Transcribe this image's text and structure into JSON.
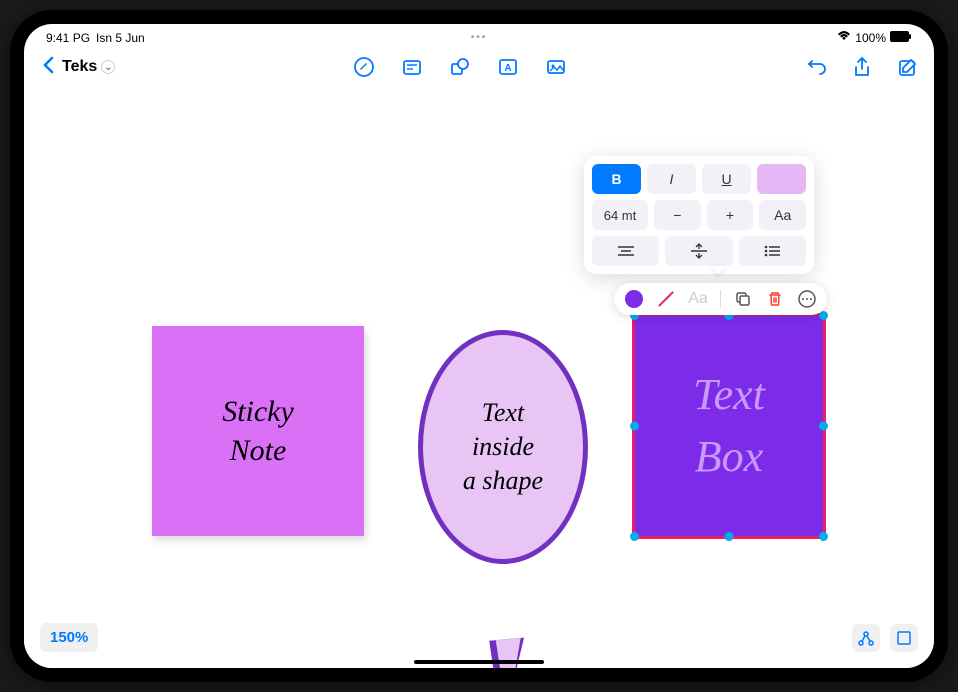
{
  "status_bar": {
    "time": "9:41 PG",
    "date": "Isn 5 Jun",
    "battery": "100%"
  },
  "toolbar": {
    "title": "Teks"
  },
  "canvas": {
    "sticky_note_text": "Sticky\nNote",
    "speech_bubble_text": "Text\ninside\na shape",
    "text_box_text": "Text\nBox",
    "zoom": "150%"
  },
  "format_panel": {
    "bold": "B",
    "italic": "I",
    "underline": "U",
    "font_size": "64 mt",
    "decrease": "−",
    "increase": "+",
    "case": "Aa"
  },
  "context_toolbar": {
    "text_format": "Aa"
  },
  "colors": {
    "sticky_note": "#da70f5",
    "bubble_fill": "#e8c5f5",
    "bubble_stroke": "#7030c0",
    "textbox_fill": "#7c2ce8",
    "textbox_stroke": "#e91e63",
    "accent": "#007aff"
  }
}
